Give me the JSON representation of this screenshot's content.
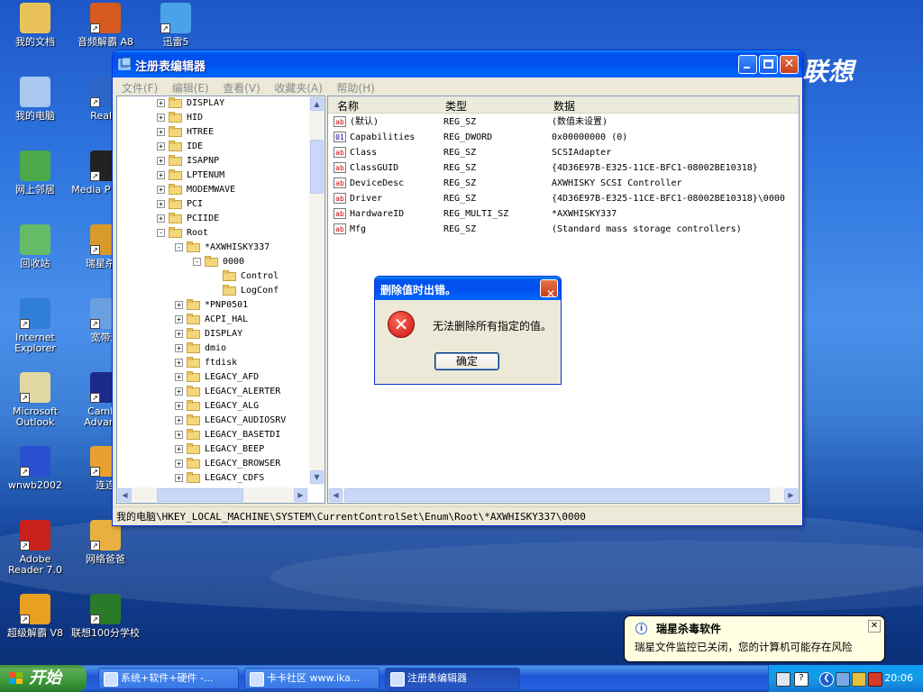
{
  "brand_text": "联想",
  "desktop_icons": [
    {
      "label": "我的文档",
      "icon": "my-documents-icon",
      "color": "#e9c35a"
    },
    {
      "label": "音频解霸 A8",
      "icon": "audio-player-icon",
      "color": "#d55a1e"
    },
    {
      "label": "迅雷5",
      "icon": "thunder-download-icon",
      "color": "#4aa3e8"
    },
    {
      "label": "我的电脑",
      "icon": "my-computer-icon",
      "color": "#a8c8f0"
    },
    {
      "label": "RealPl",
      "icon": "realplayer-icon",
      "color": "#2c66c8"
    },
    {
      "label": "网上邻居",
      "icon": "network-places-icon",
      "color": "#4caa4c"
    },
    {
      "label": "Media P Class",
      "icon": "media-player-classic-icon",
      "color": "#222222"
    },
    {
      "label": "回收站",
      "icon": "recycle-bin-icon",
      "color": "#66bb66"
    },
    {
      "label": "瑞星杀毒",
      "icon": "rising-antivirus-icon",
      "color": "#d89a2a"
    },
    {
      "label": "Internet Explorer",
      "icon": "internet-explorer-icon",
      "color": "#2f7fd8"
    },
    {
      "label": "宽带连",
      "icon": "broadband-connection-icon",
      "color": "#6aa0e0"
    },
    {
      "label": "Microsoft Outlook",
      "icon": "outlook-icon",
      "color": "#e0d8a0"
    },
    {
      "label": "Cambri Advance",
      "icon": "cambridge-dictionary-icon",
      "color": "#1b2a8a"
    },
    {
      "label": "wnwb2002",
      "icon": "wnwb-icon",
      "color": "#2850d0"
    },
    {
      "label": "连连",
      "icon": "lianlian-icon",
      "color": "#e8a030"
    },
    {
      "label": "Adobe Reader 7.0",
      "icon": "adobe-reader-icon",
      "color": "#c8201a"
    },
    {
      "label": "网络爸爸",
      "icon": "network-dad-icon",
      "color": "#e8b040"
    },
    {
      "label": "超级解霸 V8",
      "icon": "super-player-icon",
      "color": "#e8a020"
    },
    {
      "label": "联想100分学校",
      "icon": "lenovo-school-icon",
      "color": "#2a7a2a"
    }
  ],
  "window": {
    "title": "注册表编辑器",
    "menu": [
      "文件(F)",
      "编辑(E)",
      "查看(V)",
      "收藏夹(A)",
      "帮助(H)"
    ],
    "tree": [
      {
        "label": "DISPLAY",
        "depth": 2,
        "node": "+"
      },
      {
        "label": "HID",
        "depth": 2,
        "node": "+"
      },
      {
        "label": "HTREE",
        "depth": 2,
        "node": "+"
      },
      {
        "label": "IDE",
        "depth": 2,
        "node": "+"
      },
      {
        "label": "ISAPNP",
        "depth": 2,
        "node": "+"
      },
      {
        "label": "LPTENUM",
        "depth": 2,
        "node": "+"
      },
      {
        "label": "MODEMWAVE",
        "depth": 2,
        "node": "+"
      },
      {
        "label": "PCI",
        "depth": 2,
        "node": "+"
      },
      {
        "label": "PCIIDE",
        "depth": 2,
        "node": "+"
      },
      {
        "label": "Root",
        "depth": 2,
        "node": "-"
      },
      {
        "label": "*AXWHISKY337",
        "depth": 3,
        "node": "-"
      },
      {
        "label": "0000",
        "depth": 4,
        "node": "-"
      },
      {
        "label": "Control",
        "depth": 5,
        "node": ""
      },
      {
        "label": "LogConf",
        "depth": 5,
        "node": ""
      },
      {
        "label": "*PNP0501",
        "depth": 3,
        "node": "+"
      },
      {
        "label": "ACPI_HAL",
        "depth": 3,
        "node": "+"
      },
      {
        "label": "DISPLAY",
        "depth": 3,
        "node": "+"
      },
      {
        "label": "dmio",
        "depth": 3,
        "node": "+"
      },
      {
        "label": "ftdisk",
        "depth": 3,
        "node": "+"
      },
      {
        "label": "LEGACY_AFD",
        "depth": 3,
        "node": "+"
      },
      {
        "label": "LEGACY_ALERTER",
        "depth": 3,
        "node": "+"
      },
      {
        "label": "LEGACY_ALG",
        "depth": 3,
        "node": "+"
      },
      {
        "label": "LEGACY_AUDIOSRV",
        "depth": 3,
        "node": "+"
      },
      {
        "label": "LEGACY_BASETDI",
        "depth": 3,
        "node": "+"
      },
      {
        "label": "LEGACY_BEEP",
        "depth": 3,
        "node": "+"
      },
      {
        "label": "LEGACY_BROWSER",
        "depth": 3,
        "node": "+"
      },
      {
        "label": "LEGACY_CDFS",
        "depth": 3,
        "node": "+"
      }
    ],
    "columns": {
      "name": "名称",
      "type": "类型",
      "data": "数据"
    },
    "values": [
      {
        "name": "(默认)",
        "type": "REG_SZ",
        "data": "(数值未设置)",
        "kind": "ab"
      },
      {
        "name": "Capabilities",
        "type": "REG_DWORD",
        "data": "0x00000000 (0)",
        "kind": "bin"
      },
      {
        "name": "Class",
        "type": "REG_SZ",
        "data": "SCSIAdapter",
        "kind": "ab"
      },
      {
        "name": "ClassGUID",
        "type": "REG_SZ",
        "data": "{4D36E97B-E325-11CE-BFC1-08002BE10318}",
        "kind": "ab"
      },
      {
        "name": "DeviceDesc",
        "type": "REG_SZ",
        "data": "AXWHISKY SCSI Controller",
        "kind": "ab"
      },
      {
        "name": "Driver",
        "type": "REG_SZ",
        "data": "{4D36E97B-E325-11CE-BFC1-08002BE10318}\\0000",
        "kind": "ab"
      },
      {
        "name": "HardwareID",
        "type": "REG_MULTI_SZ",
        "data": "*AXWHISKY337",
        "kind": "ab"
      },
      {
        "name": "Mfg",
        "type": "REG_SZ",
        "data": "(Standard mass storage controllers)",
        "kind": "ab"
      }
    ],
    "status": "我的电脑\\HKEY_LOCAL_MACHINE\\SYSTEM\\CurrentControlSet\\Enum\\Root\\*AXWHISKY337\\0000"
  },
  "dialog": {
    "title": "删除值时出错。",
    "message": "无法删除所有指定的值。",
    "ok_label": "确定"
  },
  "taskbar": {
    "start_label": "开始",
    "buttons": [
      "系统+软件+硬件 -...",
      "卡卡社区 www.ika...",
      "注册表编辑器"
    ],
    "active_index": 2,
    "clock": "20:06"
  },
  "balloon": {
    "title": "瑞星杀毒软件",
    "message": "瑞星文件监控已关闭，您的计算机可能存在风险"
  }
}
